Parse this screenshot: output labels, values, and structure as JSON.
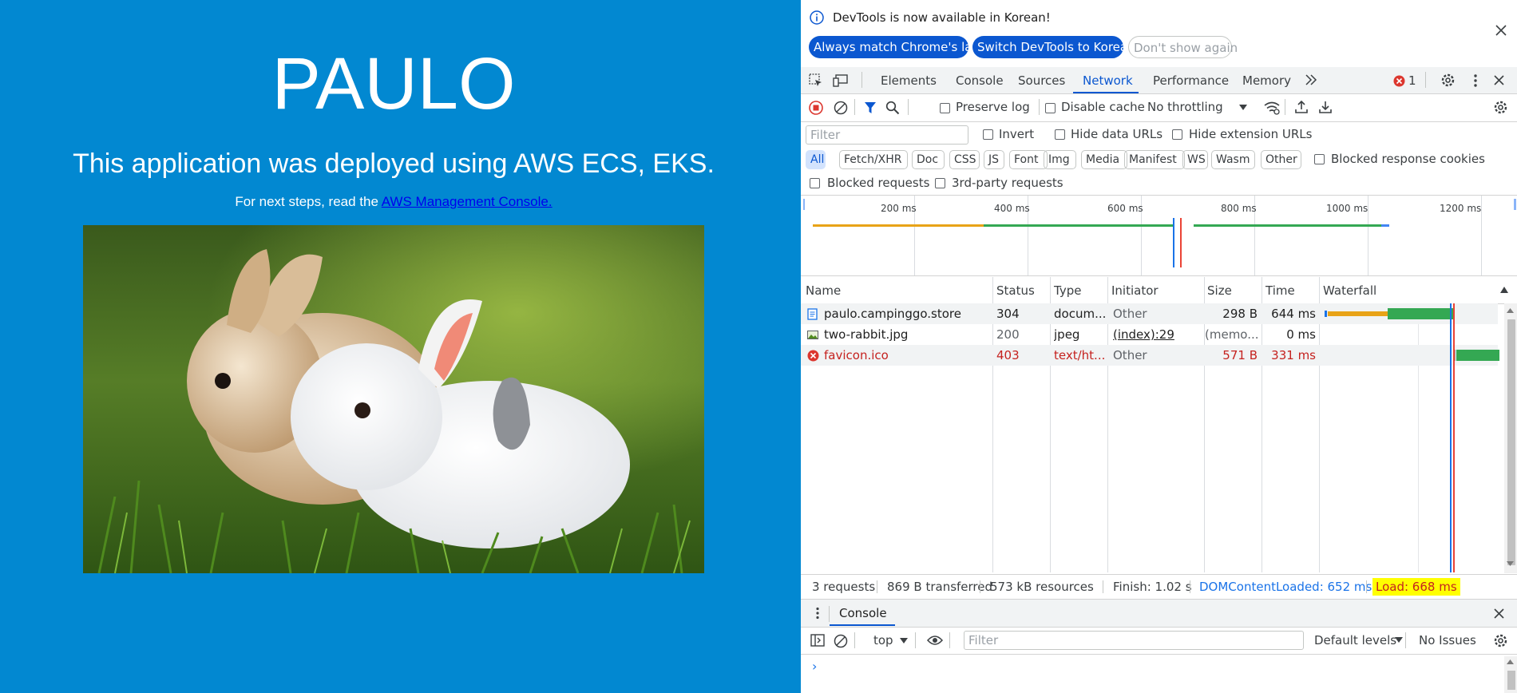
{
  "page": {
    "title": "PAULO",
    "subtitle": "This application was deployed using AWS ECS, EKS.",
    "steps_text": "For next steps, read the ",
    "steps_link": "AWS Management Console."
  },
  "devtools": {
    "infobar": {
      "message": "DevTools is now available in Korean!",
      "btn_match": "Always match Chrome's language",
      "btn_switch": "Switch DevTools to Korean",
      "btn_dismiss": "Don't show again"
    },
    "tabs": [
      "Elements",
      "Console",
      "Sources",
      "Network",
      "Performance",
      "Memory"
    ],
    "active_tab": "Network",
    "error_count": "1",
    "toolbar": {
      "preserve_log": "Preserve log",
      "disable_cache": "Disable cache",
      "throttling": "No throttling"
    },
    "filter": {
      "placeholder": "Filter",
      "invert": "Invert",
      "hide_data_urls": "Hide data URLs",
      "hide_extension_urls": "Hide extension URLs",
      "types": [
        "All",
        "Fetch/XHR",
        "Doc",
        "CSS",
        "JS",
        "Font",
        "Img",
        "Media",
        "Manifest",
        "WS",
        "Wasm",
        "Other"
      ],
      "blocked_response_cookies": "Blocked response cookies",
      "blocked_requests": "Blocked requests",
      "third_party": "3rd-party requests"
    },
    "overview_ticks": [
      "200 ms",
      "400 ms",
      "600 ms",
      "800 ms",
      "1000 ms",
      "1200 ms"
    ],
    "columns": [
      "Name",
      "Status",
      "Type",
      "Initiator",
      "Size",
      "Time",
      "Waterfall"
    ],
    "rows": [
      {
        "name": "paulo.campinggo.store",
        "status": "304",
        "type": "docum...",
        "initiator": "Other",
        "size": "298 B",
        "time": "644 ms"
      },
      {
        "name": "two-rabbit.jpg",
        "status": "200",
        "type": "jpeg",
        "initiator": "(index):29",
        "size": "(memo...",
        "time": "0 ms"
      },
      {
        "name": "favicon.ico",
        "status": "403",
        "type": "text/ht...",
        "initiator": "Other",
        "size": "571 B",
        "time": "331 ms"
      }
    ],
    "summary": {
      "requests": "3 requests",
      "transferred": "869 B transferred",
      "resources": "573 kB resources",
      "finish": "Finish: 1.02 s",
      "dcl": "DOMContentLoaded: 652 ms",
      "load": "Load: 668 ms"
    },
    "console": {
      "tab_label": "Console",
      "context": "top",
      "filter_placeholder": "Filter",
      "levels": "Default levels",
      "issues": "No Issues",
      "prompt": "›"
    },
    "colors": {
      "accent": "#0b57d0",
      "error": "#c5221f",
      "highlight": "#ffff00",
      "page_bg": "#0288d1"
    }
  }
}
